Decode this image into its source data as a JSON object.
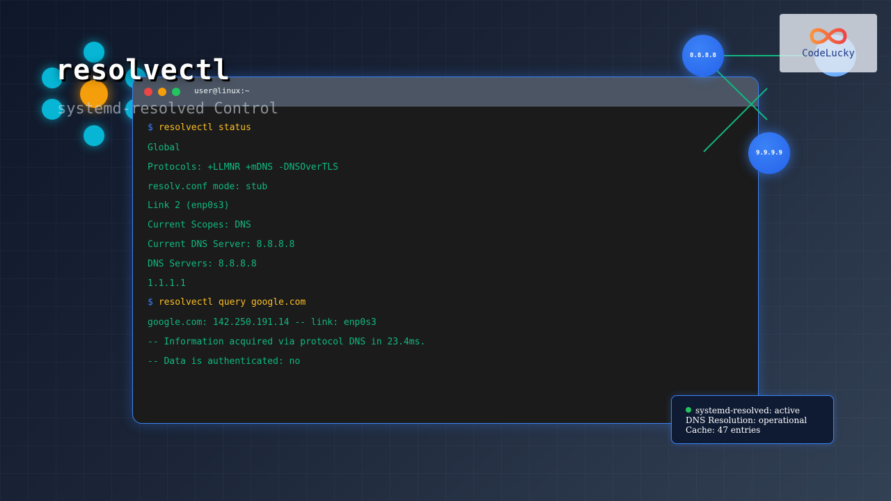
{
  "title": "resolvectl",
  "subtitle": "systemd-resolved Control",
  "terminal": {
    "window_title": "user@linux:~",
    "prompt": "$",
    "command1": "resolvectl status",
    "output1": [
      "Global",
      "Protocols: +LLMNR +mDNS -DNSOverTLS",
      "resolv.conf mode: stub",
      "Link 2 (enp0s3)",
      "Current Scopes: DNS",
      "Current DNS Server: 8.8.8.8",
      "DNS Servers: 8.8.8.8",
      "1.1.1.1"
    ],
    "command2": "resolvectl query google.com",
    "output2": [
      "google.com: 142.250.191.14 -- link: enp0s3",
      "-- Information acquired via protocol DNS in 23.4ms.",
      "-- Data is authenticated: no"
    ]
  },
  "dns_nodes": {
    "primary": "8.8.8.8",
    "secondary": "9.9.9.9"
  },
  "logo": {
    "text": "CodeLucky"
  },
  "status": {
    "service": "systemd-resolved: active",
    "resolution": "DNS Resolution: operational",
    "cache": "Cache: 47 entries"
  },
  "colors": {
    "accent": "#3b82f6",
    "terminal_text": "#10b981",
    "command_text": "#fbbf24",
    "status_active": "#22c55e"
  }
}
